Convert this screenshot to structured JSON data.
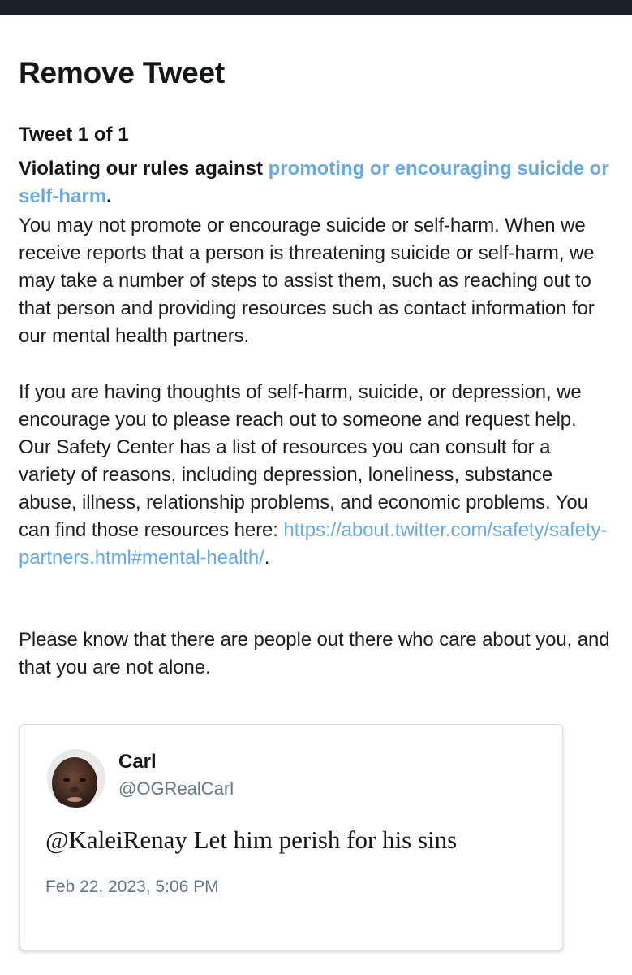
{
  "header": {
    "title": "Remove Tweet"
  },
  "notice": {
    "tweet_count": "Tweet 1 of 1",
    "violation_prefix": "Violating our rules against ",
    "violation_link": "promoting or encouraging suicide or self-harm",
    "violation_suffix": ".",
    "paragraph1": "You may not promote or encourage suicide or self-harm. When we receive reports that a person is threatening suicide or self-harm, we may take a number of steps to assist them, such as reaching out to that person and providing resources such as contact information for our mental health partners.",
    "paragraph2_text": "If you are having thoughts of self-harm, suicide, or depression, we encourage you to please reach out to someone and request help. Our Safety Center has a list of resources you can consult for a variety of reasons, including depression, loneliness, substance abuse, illness, relationship problems, and economic problems. You can find those resources here: ",
    "paragraph2_link": "https://about.twitter.com/safety/safety-partners.html#mental-health/",
    "paragraph2_end": ".",
    "paragraph3": "Please know that there are people out there who care about you, and that you are not alone."
  },
  "tweet": {
    "name": "Carl",
    "handle": "@OGRealCarl",
    "text": "@KaleiRenay Let him perish for his sins",
    "timestamp": "Feb 22, 2023, 5:06 PM"
  },
  "colors": {
    "top_bar": "#1a212b",
    "link": "#6aa9e0",
    "muted": "#657786"
  }
}
